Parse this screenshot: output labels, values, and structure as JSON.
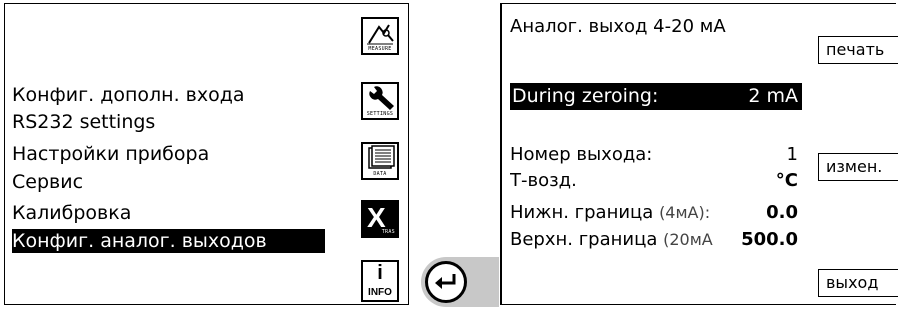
{
  "menu": {
    "items": [
      {
        "label": "Конфиг. дополн. входа"
      },
      {
        "label": "RS232 settings"
      },
      {
        "label": "Настройки прибора"
      },
      {
        "label": "Сервис"
      },
      {
        "label": "Калибровка"
      },
      {
        "label": "Конфиг. аналог. выходов",
        "selected": true
      }
    ]
  },
  "side_icons": {
    "measure": "MEASURE",
    "settings": "SETTINGS",
    "data": "DATA",
    "xtras": "TRAS",
    "info": "INFO",
    "xtras_letter": "X",
    "info_letter": "i"
  },
  "detail": {
    "title": "Аналог. выход 4-20 мА",
    "highlight": {
      "label": "During zeroing:",
      "value": "2 mA"
    },
    "rows": [
      {
        "label": "Номер выхода:",
        "hint": "",
        "value": "1"
      },
      {
        "label": "Т-возд.",
        "hint": "",
        "value": "°C"
      },
      {
        "label": "Нижн. граница",
        "hint": "(4мА):",
        "value": "0.0"
      },
      {
        "label": "Верхн. граница",
        "hint": "(20мА",
        "value": "500.0"
      }
    ]
  },
  "buttons": {
    "print": "печать",
    "change": "измен.",
    "exit": "выход"
  },
  "icons": {
    "enter": "enter-return-icon"
  }
}
